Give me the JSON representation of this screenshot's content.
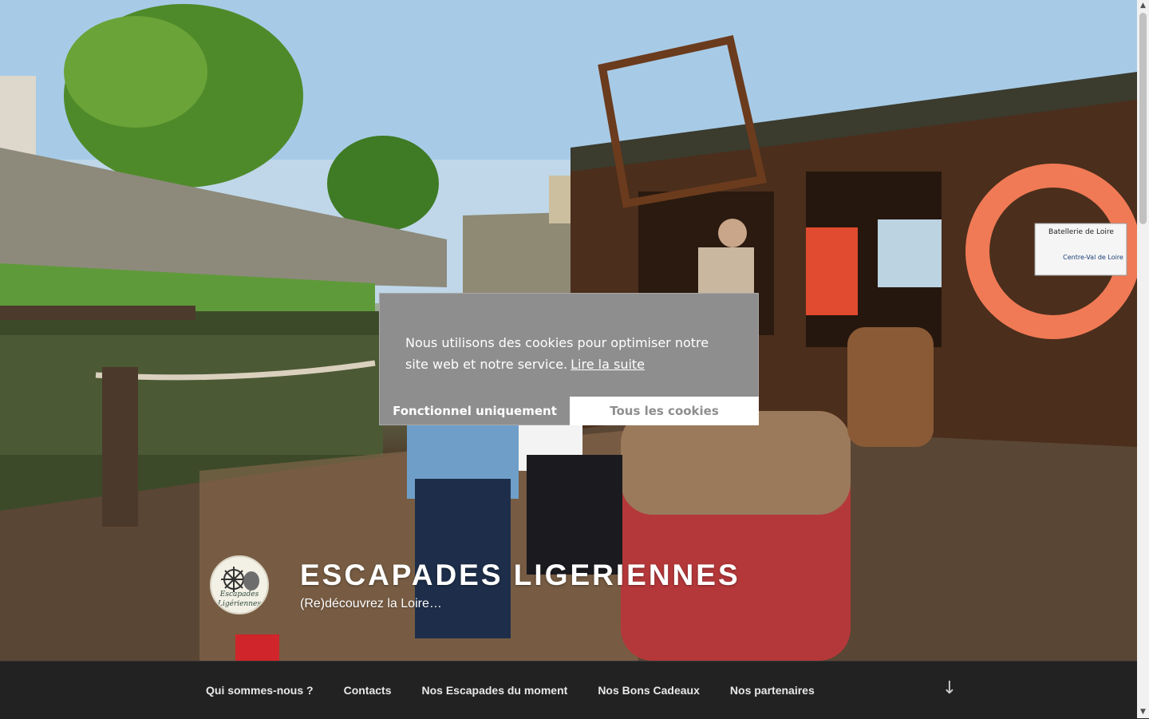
{
  "site": {
    "title": "ESCAPADES LIGERIENNES",
    "tagline": "(Re)découvrez la Loire…",
    "logo_text_line1": "Escapades",
    "logo_text_line2": "Ligériennes"
  },
  "hero": {
    "sign_title": "Batellerie de Loire",
    "sign_region": "Centre-Val de Loire"
  },
  "nav": {
    "items": [
      {
        "label": "Qui sommes-nous ?"
      },
      {
        "label": "Contacts"
      },
      {
        "label": "Nos Escapades du moment"
      },
      {
        "label": "Nos Bons Cadeaux"
      },
      {
        "label": "Nos partenaires"
      }
    ],
    "scroll_icon": "arrow-down-icon"
  },
  "cookie": {
    "message": "Nous utilisons des cookies pour optimiser notre site web et notre service.",
    "link_label": "Lire la suite",
    "button_functional": "Fonctionnel uniquement",
    "button_all": "Tous les cookies"
  },
  "colors": {
    "nav_bg": "#222222",
    "cookie_bg": "#8e8e8e",
    "text_light": "#ffffff"
  }
}
